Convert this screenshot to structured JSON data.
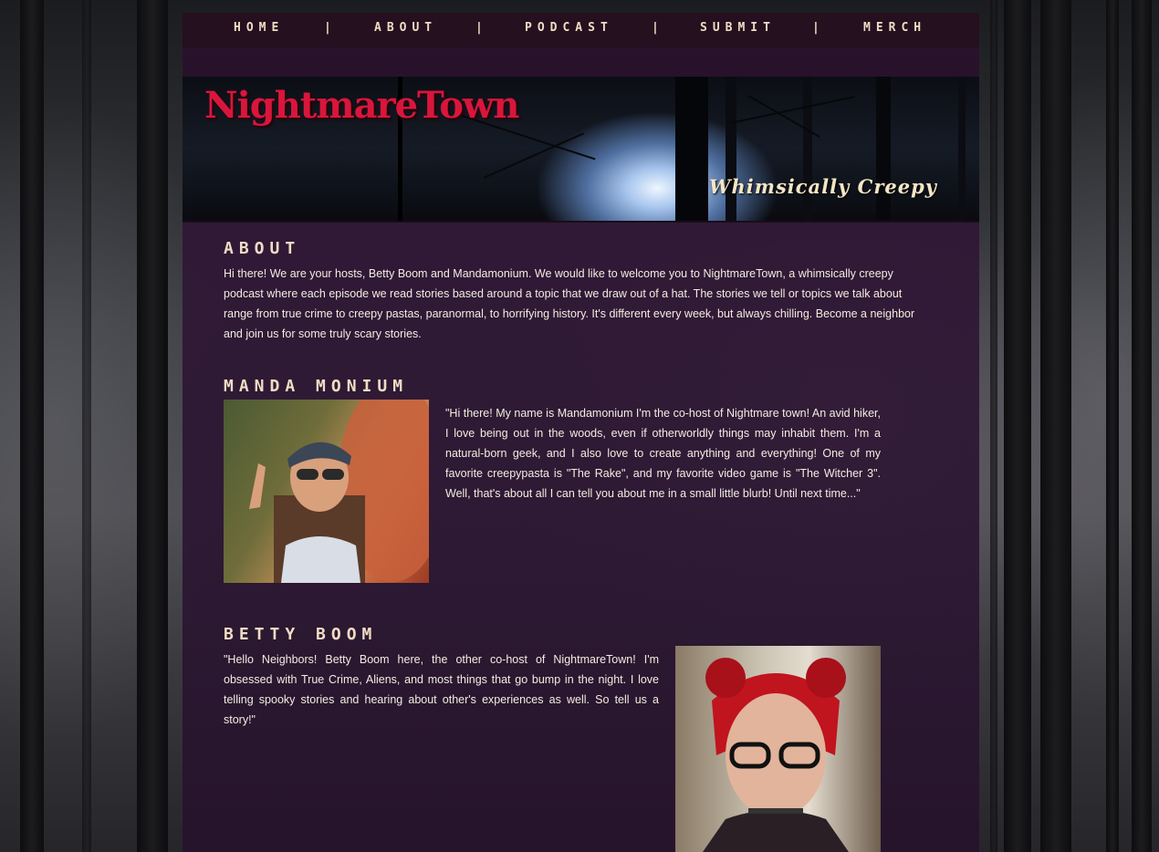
{
  "nav": {
    "items": [
      {
        "label": "HOME"
      },
      {
        "label": "ABOUT"
      },
      {
        "label": "PODCAST"
      },
      {
        "label": "SUBMIT"
      },
      {
        "label": "MERCH"
      }
    ],
    "separator": "|"
  },
  "banner": {
    "title": "NightmareTown",
    "tagline": "Whimsically Creepy"
  },
  "about": {
    "heading": "ABOUT",
    "text": "Hi there! We are your hosts, Betty Boom and Mandamonium. We would like to welcome you to NightmareTown, a whimsically creepy podcast where each episode we read stories based around a topic that we draw out of a hat. The stories we tell or topics we talk about range from true crime to creepy pastas, paranormal, to horrifying history. It's different every week, but always chilling. Become a neighbor and join us for some truly scary stories."
  },
  "manda": {
    "heading": "MANDA MONIUM",
    "text": "\"Hi there! My name is Mandamonium I'm the co-host of Nightmare town! An avid hiker, I love being out in the woods, even if otherworldly things may inhabit them. I'm a natural-born geek, and I also love to create anything and everything! One of my favorite creepypasta is \"The Rake\", and my favorite video game is \"The Witcher 3\". Well, that's about all I can tell you about me in a small little blurb! Until next time...\""
  },
  "betty": {
    "heading": "BETTY BOOM",
    "text": "\"Hello Neighbors! Betty Boom here, the other co-host of NightmareTown! I'm obsessed with True Crime, Aliens, and most things that go bump in the night. I love telling spooky stories and hearing about other's experiences as well. So tell us a story!\""
  },
  "colors": {
    "page_panel": "#2e1533",
    "nav_bg": "#24101f",
    "heading_text": "#f1dcc4",
    "logo_red": "#d8163c",
    "body_text": "#f3ece0"
  }
}
